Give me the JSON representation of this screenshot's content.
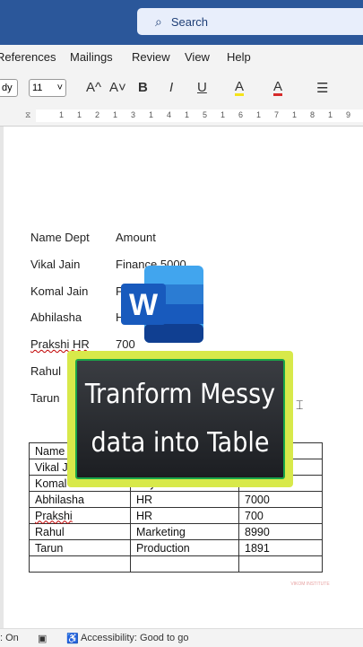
{
  "search": {
    "label": "Search"
  },
  "menu": [
    "References",
    "Mailings",
    "Review",
    "View",
    "Help"
  ],
  "toolbar": {
    "font_name_partial": "dy",
    "font_size": "11",
    "grow_font": "A^",
    "shrink_font": "A˅",
    "bold": "B",
    "italic": "I",
    "underline": "U",
    "highlight": "A",
    "font_color": "A"
  },
  "ruler": [
    "1",
    "1",
    "2",
    "1",
    "3",
    "1",
    "4",
    "1",
    "5",
    "1",
    "6",
    "1",
    "7",
    "1",
    "8",
    "1",
    "9"
  ],
  "doc": {
    "lines": [
      [
        "Name   Dept",
        "Amount"
      ],
      [
        "Vikal Jain",
        "Finance 5000"
      ],
      [
        "Komal Jain",
        "P"
      ],
      [
        "Abhilasha",
        "H"
      ],
      [
        "Prakshi  HR",
        "700"
      ],
      [
        "Rahul",
        ""
      ],
      [
        "Tarun",
        ""
      ]
    ],
    "table": [
      [
        "Name",
        "",
        ""
      ],
      [
        "Vikal J",
        "",
        ""
      ],
      [
        "Komal Jain",
        "Payroll",
        "8000"
      ],
      [
        "Abhilasha",
        "HR",
        "7000"
      ],
      [
        "Prakshi",
        "HR",
        "700"
      ],
      [
        "Rahul",
        "Marketing",
        "8990"
      ],
      [
        "Tarun",
        "Production",
        "1891"
      ],
      [
        "",
        "",
        ""
      ]
    ]
  },
  "overlay": {
    "line1": "Tranform Messy",
    "line2": "data into Table",
    "logo_letter": "W"
  },
  "watermark": "VIKOM INSTITUTE",
  "status": {
    "left": ": On",
    "accessibility": "Accessibility: Good to go"
  }
}
